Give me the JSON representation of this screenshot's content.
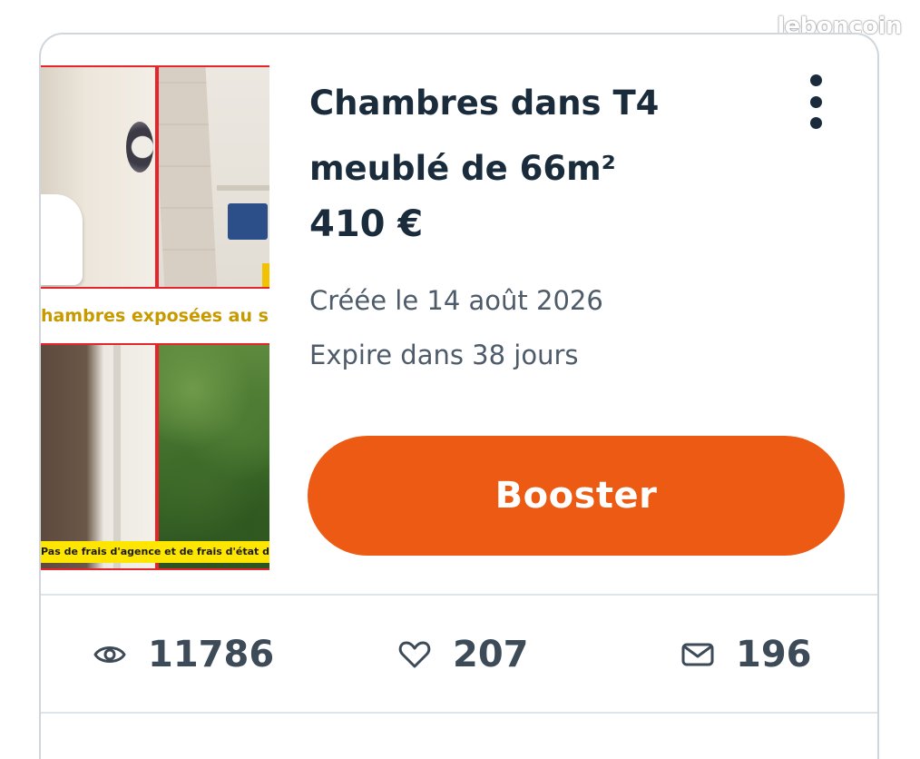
{
  "watermark": "leboncoin",
  "listing": {
    "title": "Chambres dans T4 meublé de 66m²",
    "price": "410 €",
    "created": "Créée le 14 août 2026",
    "expires": "Expire dans 38 jours",
    "photo_captions": [
      "Chambres exposées au sud avec vue",
      "Pas de frais d'agence et de frais d'état des lieux entrant et sortant"
    ]
  },
  "actions": {
    "booster_label": "Booster",
    "more_icon": "more-vertical-icon"
  },
  "stats": {
    "views": "11786",
    "favorites": "207",
    "messages": "196"
  },
  "colors": {
    "accent": "#ec5a13",
    "text": "#1a2b3c",
    "muted": "#4d5b6a",
    "border": "#cfd6dd"
  }
}
